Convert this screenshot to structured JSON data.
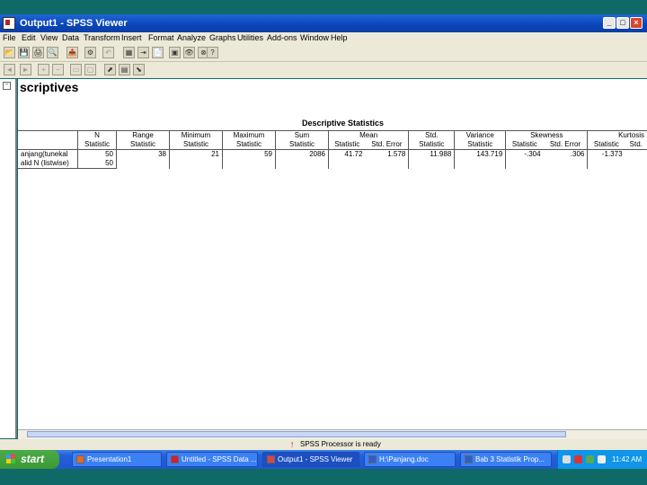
{
  "window": {
    "title": "Output1 - SPSS Viewer",
    "controls": [
      "_",
      "□",
      "×"
    ]
  },
  "menu": [
    "File",
    "Edit",
    "View",
    "Data",
    "Transform",
    "Insert",
    "Format",
    "Analyze",
    "Graphs",
    "Utilities",
    "Add-ons",
    "Window",
    "Help"
  ],
  "toolbar": {
    "row1": [
      "📂",
      "💾",
      "🖨",
      "🔍",
      "📤",
      "⚙",
      "↶",
      "▦",
      "⇥",
      "📄",
      "▣",
      "👁",
      "⊗",
      "?"
    ],
    "row2": [
      "◄",
      "►",
      "+",
      "−",
      "▭",
      "▢",
      "⬈",
      "▤",
      "⬊"
    ]
  },
  "outline_mark": "−",
  "content": {
    "heading": "scriptives",
    "table_title": "Descriptive Statistics",
    "header1": [
      "N",
      "Range",
      "Minimum",
      "Maximum",
      "Sum",
      "Mean",
      "Std.",
      "Variance",
      "Skewness",
      "Kurtosis"
    ],
    "header2": [
      "Statistic",
      "Statistic",
      "Statistic",
      "Statistic",
      "Statistic",
      "Statistic",
      "Std. Error",
      "Statistic",
      "Statistic",
      "Statistic",
      "Std. Error",
      "Statistic",
      "Std."
    ],
    "rows": [
      {
        "label": "anjang(tunekal",
        "cells": [
          "50",
          "38",
          "21",
          "59",
          "2086",
          "41.72",
          "1.578",
          "11.988",
          "143.719",
          "-.304",
          ".306",
          "-1.373",
          ""
        ]
      },
      {
        "label": "alid N (listwise)",
        "cells": [
          "50",
          "",
          "",
          "",
          "",
          "",
          "",
          "",
          "",
          "",
          "",
          "",
          ""
        ]
      }
    ]
  },
  "status": {
    "icon": "!",
    "text": "SPSS Processor is ready"
  },
  "taskbar": {
    "start_label": "start",
    "tasks": [
      "Presentation1",
      "Untitled - SPSS Data ...",
      "Output1 - SPSS Viewer",
      "H:\\Panjang.doc",
      "Bab 3 Statistik Prop..."
    ],
    "clock": "11:42 AM"
  },
  "colors": {
    "titlebar": "#0a44b8",
    "taskbar": "#245edb",
    "start": "#3b9a36",
    "desktop": "#0f6a67"
  }
}
